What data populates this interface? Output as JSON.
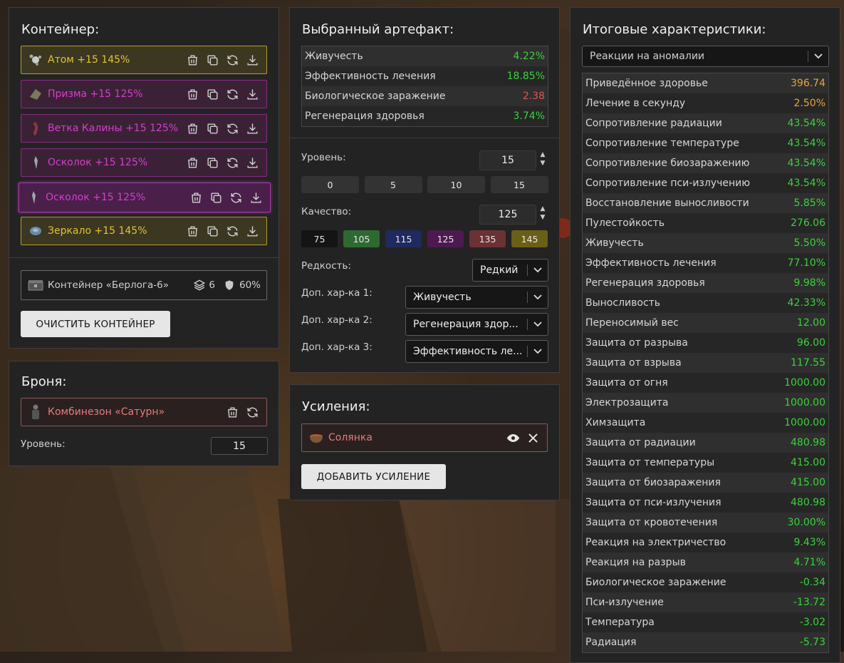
{
  "container": {
    "title": "Контейнер:",
    "items": [
      {
        "label": "Атом +15 145%",
        "style": "gold"
      },
      {
        "label": "Призма +15 125%",
        "style": "purple"
      },
      {
        "label": "Ветка Калины +15 125%",
        "style": "purple"
      },
      {
        "label": "Осколок +15 125%",
        "style": "purple"
      },
      {
        "label": "Осколок +15 125%",
        "style": "purple-selected"
      },
      {
        "label": "Зеркало +15 145%",
        "style": "gold"
      }
    ],
    "info": {
      "name": "Контейнер «Берлога-6»",
      "slots": "6",
      "protection": "60%"
    },
    "clear_button": "ОЧИСТИТЬ КОНТЕЙНЕР"
  },
  "armor": {
    "title": "Броня:",
    "item": "Комбинезон «Сатурн»",
    "level_label": "Уровень:",
    "level_value": "15"
  },
  "artifact": {
    "title": "Выбранный артефакт:",
    "stats": [
      {
        "name": "Живучесть",
        "value": "4.22%",
        "color": "green"
      },
      {
        "name": "Эффективность лечения",
        "value": "18.85%",
        "color": "green"
      },
      {
        "name": "Биологическое заражение",
        "value": "2.38",
        "color": "red"
      },
      {
        "name": "Регенерация здоровья",
        "value": "3.74%",
        "color": "green"
      }
    ],
    "level_label": "Уровень:",
    "level_value": "15",
    "level_presets": [
      "0",
      "5",
      "10",
      "15"
    ],
    "quality_label": "Качество:",
    "quality_value": "125",
    "quality_presets": [
      {
        "label": "75",
        "color": "#141414"
      },
      {
        "label": "105",
        "color": "#2d6a31"
      },
      {
        "label": "115",
        "color": "#1f2a5e"
      },
      {
        "label": "125",
        "color": "#4d1a4f"
      },
      {
        "label": "135",
        "color": "#6b3234"
      },
      {
        "label": "145",
        "color": "#6b5e16"
      }
    ],
    "rarity_label": "Редкость:",
    "rarity_value": "Редкий",
    "extra1_label": "Доп. хар-ка 1:",
    "extra1_value": "Живучесть",
    "extra2_label": "Доп. хар-ка 2:",
    "extra2_value": "Регенерация здор...",
    "extra3_label": "Доп. хар-ка 3:",
    "extra3_value": "Эффективность ле..."
  },
  "boosts": {
    "title": "Усиления:",
    "item": "Солянка",
    "add_button": "ДОБАВИТЬ УСИЛЕНИЕ"
  },
  "totals": {
    "title": "Итоговые характеристики:",
    "filter_value": "Реакции на аномалии",
    "stats": [
      {
        "name": "Приведённое здоровье",
        "value": "396.74",
        "color": "orange"
      },
      {
        "name": "Лечение в секунду",
        "value": "2.50%",
        "color": "orange"
      },
      {
        "name": "Сопротивление радиации",
        "value": "43.54%",
        "color": "green"
      },
      {
        "name": "Сопротивление температуре",
        "value": "43.54%",
        "color": "green"
      },
      {
        "name": "Сопротивление биозаражению",
        "value": "43.54%",
        "color": "green"
      },
      {
        "name": "Сопротивление пси-излучению",
        "value": "43.54%",
        "color": "green"
      },
      {
        "name": "Восстановление выносливости",
        "value": "5.85%",
        "color": "green"
      },
      {
        "name": "Пулестойкость",
        "value": "276.06",
        "color": "green"
      },
      {
        "name": "Живучесть",
        "value": "5.50%",
        "color": "green"
      },
      {
        "name": "Эффективность лечения",
        "value": "77.10%",
        "color": "green"
      },
      {
        "name": "Регенерация здоровья",
        "value": "9.98%",
        "color": "green"
      },
      {
        "name": "Выносливость",
        "value": "42.33%",
        "color": "green"
      },
      {
        "name": "Переносимый вес",
        "value": "12.00",
        "color": "green"
      },
      {
        "name": "Защита от разрыва",
        "value": "96.00",
        "color": "green"
      },
      {
        "name": "Защита от взрыва",
        "value": "117.55",
        "color": "green"
      },
      {
        "name": "Защита от огня",
        "value": "1000.00",
        "color": "green"
      },
      {
        "name": "Электрозащита",
        "value": "1000.00",
        "color": "green"
      },
      {
        "name": "Химзащита",
        "value": "1000.00",
        "color": "green"
      },
      {
        "name": "Защита от радиации",
        "value": "480.98",
        "color": "green"
      },
      {
        "name": "Защита от температуры",
        "value": "415.00",
        "color": "green"
      },
      {
        "name": "Защита от биозаражения",
        "value": "415.00",
        "color": "green"
      },
      {
        "name": "Защита от пси-излучения",
        "value": "480.98",
        "color": "green"
      },
      {
        "name": "Защита от кровотечения",
        "value": "30.00%",
        "color": "green"
      },
      {
        "name": "Реакция на электричество",
        "value": "9.43%",
        "color": "green"
      },
      {
        "name": "Реакция на разрыв",
        "value": "4.71%",
        "color": "green"
      },
      {
        "name": "Биологическое заражение",
        "value": "-0.34",
        "color": "green"
      },
      {
        "name": "Пси-излучение",
        "value": "-13.72",
        "color": "green"
      },
      {
        "name": "Температура",
        "value": "-3.02",
        "color": "green"
      },
      {
        "name": "Радиация",
        "value": "-5.73",
        "color": "green"
      }
    ]
  }
}
